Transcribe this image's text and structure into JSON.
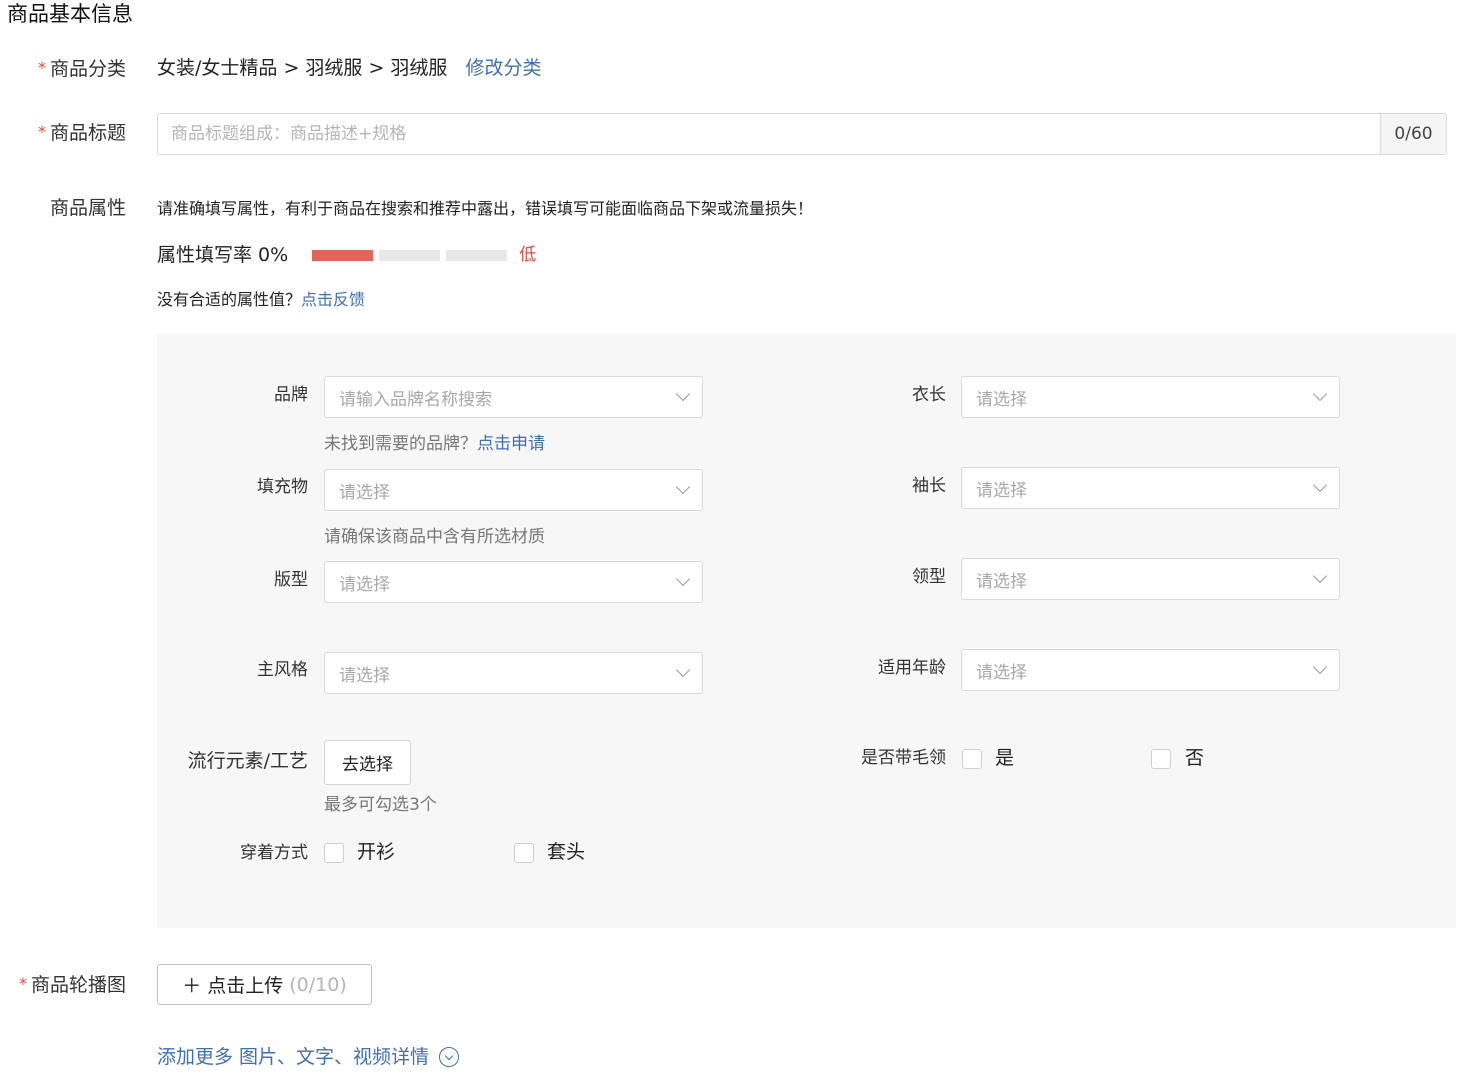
{
  "section_title": "商品基本信息",
  "required_mark": "*",
  "category": {
    "label": "商品分类",
    "path": "女装/女士精品 > 羽绒服 > 羽绒服",
    "edit_link": "修改分类"
  },
  "title_field": {
    "label": "商品标题",
    "placeholder": "商品标题组成：商品描述+规格",
    "value": "",
    "counter": "0/60"
  },
  "attributes": {
    "label": "商品属性",
    "note": "请准确填写属性，有利于商品在搜索和推荐中露出，错误填写可能面临商品下架或流量损失！",
    "fill_rate_label": "属性填写率 0%",
    "fill_rate_fraction": 0,
    "fill_rate_level": "低",
    "feedback_prefix": "没有合适的属性值？",
    "feedback_link": "点击反馈"
  },
  "fields": {
    "brand": {
      "label": "品牌",
      "placeholder": "请输入品牌名称搜索",
      "hint_prefix": "未找到需要的品牌？",
      "hint_link": "点击申请"
    },
    "length": {
      "label": "衣长",
      "placeholder": "请选择"
    },
    "filling": {
      "label": "填充物",
      "placeholder": "请选择",
      "hint": "请确保该商品中含有所选材质"
    },
    "sleeve": {
      "label": "袖长",
      "placeholder": "请选择"
    },
    "fit": {
      "label": "版型",
      "placeholder": "请选择"
    },
    "collar": {
      "label": "领型",
      "placeholder": "请选择"
    },
    "style": {
      "label": "主风格",
      "placeholder": "请选择"
    },
    "age": {
      "label": "适用年龄",
      "placeholder": "请选择"
    },
    "elements": {
      "label": "流行元素/工艺",
      "button": "去选择",
      "hint": "最多可勾选3个"
    },
    "fur_collar": {
      "label": "是否带毛领",
      "options": [
        "是",
        "否"
      ]
    },
    "wearing": {
      "label": "穿着方式",
      "options": [
        "开衫",
        "套头"
      ]
    }
  },
  "carousel": {
    "label": "商品轮播图",
    "upload_button": "＋ 点击上传",
    "count": "(0/10)"
  },
  "more_details_link": "添加更多 图片、文字、视频详情",
  "colors": {
    "accent_link": "#3f6fb6",
    "required": "#e1493f",
    "rate_bar": "#e1665c",
    "panel_bg": "#f7f7f7"
  },
  "icons": [
    "chevron-down-icon",
    "circle-chevron-down-icon",
    "plus-icon"
  ]
}
